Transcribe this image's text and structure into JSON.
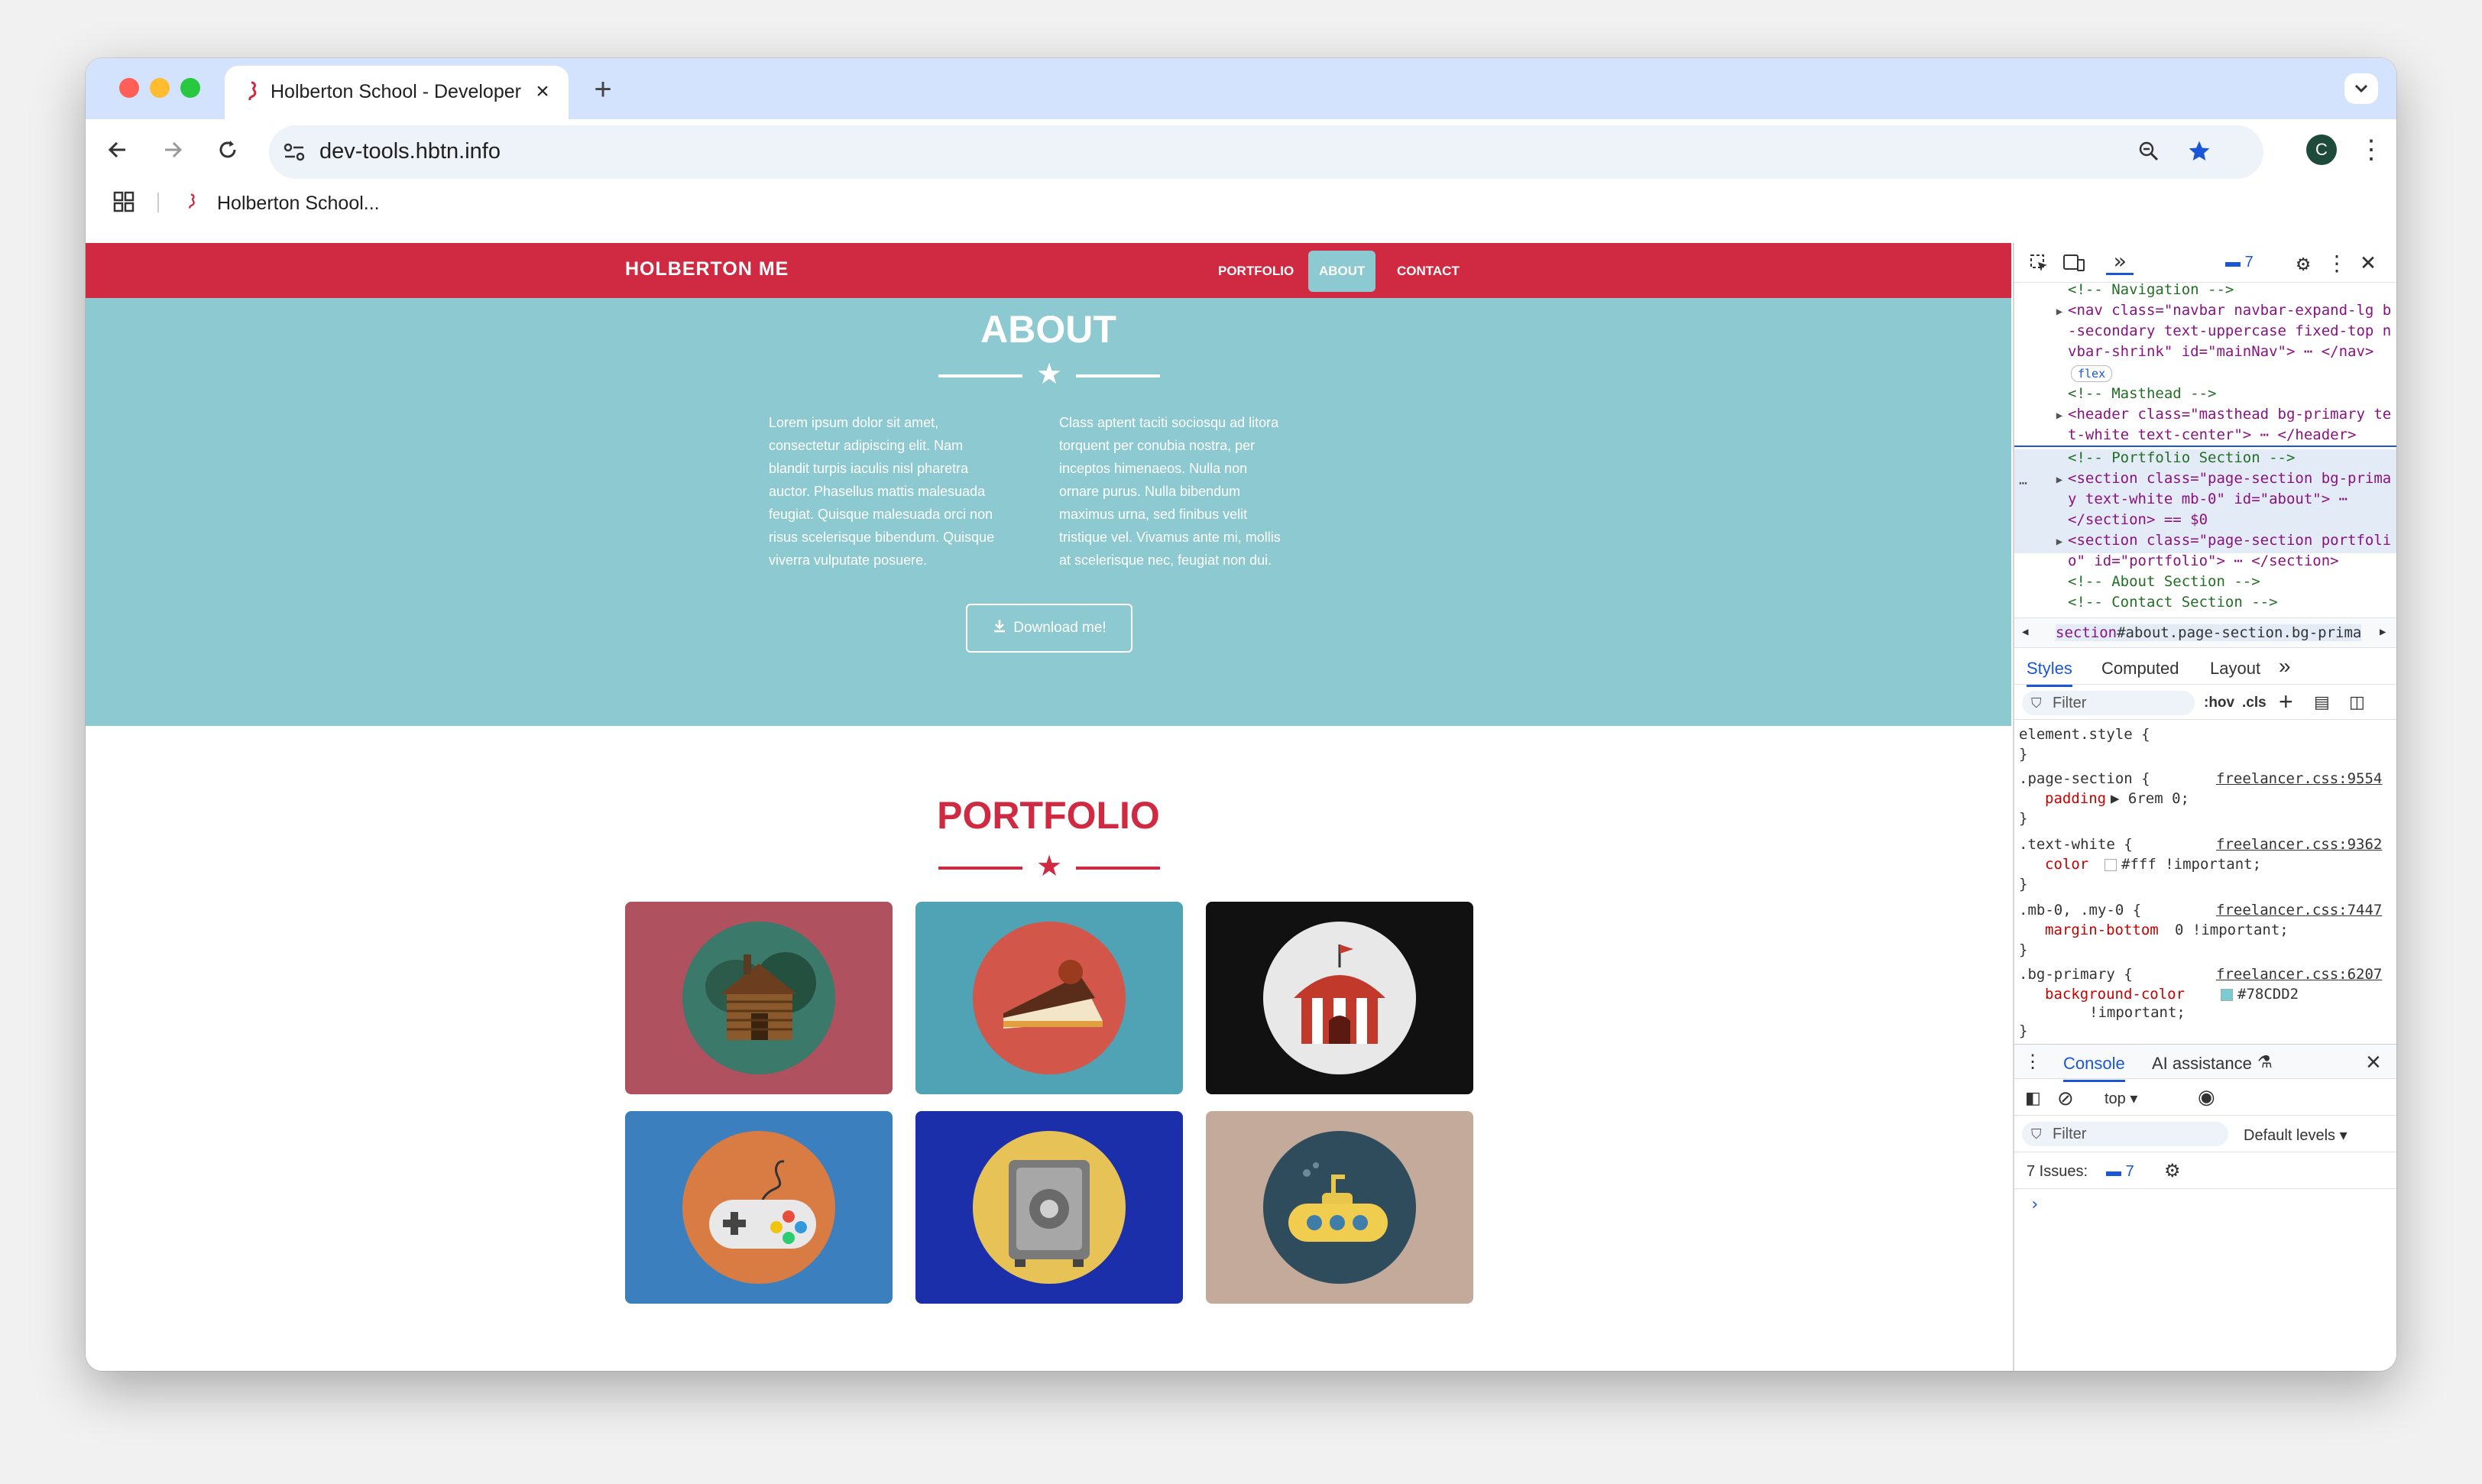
{
  "browser": {
    "tab_title": "Holberton School - Developer",
    "url": "dev-tools.hbtn.info",
    "bookmark_label": "Holberton School...",
    "profile_initial": "C",
    "colors": {
      "tabbar": "#d3e3fd",
      "close": "#ff5f57",
      "minimize": "#febc2e",
      "maximize": "#28c840"
    }
  },
  "site": {
    "brand": "HOLBERTON ME",
    "nav": [
      "PORTFOLIO",
      "ABOUT",
      "CONTACT"
    ],
    "active_nav": "ABOUT",
    "about_title": "ABOUT",
    "about_col1": "Lorem ipsum dolor sit amet, consectetur adipiscing elit. Nam blandit turpis iaculis nisl pharetra auctor. Phasellus mattis malesuada feugiat. Quisque malesuada orci non risus scelerisque bibendum. Quisque viverra vulputate posuere.",
    "about_col2": "Class aptent taciti sociosqu ad litora torquent per conubia nostra, per inceptos himenaeos. Nulla non ornare purus. Nulla bibendum maximus urna, sed finibus velit tristique vel. Vivamus ante mi, mollis at scelerisque nec, feugiat non dui.",
    "download_label": "Download me!",
    "portfolio_title": "PORTFOLIO",
    "portfolio_items": [
      {
        "name": "cabin",
        "bg": "#b05160",
        "circle": "#3b7a6a"
      },
      {
        "name": "cake",
        "bg": "#4fa3b5",
        "circle": "#d2574a"
      },
      {
        "name": "circus",
        "bg": "#111111",
        "circle": "#e8e8e8"
      },
      {
        "name": "game",
        "bg": "#3b7fbf",
        "circle": "#d97c43"
      },
      {
        "name": "safe",
        "bg": "#1b2faa",
        "circle": "#e7c257"
      },
      {
        "name": "submarine",
        "bg": "#c4aa9b",
        "circle": "#2f4c5c"
      }
    ],
    "colors": {
      "primary": "#cf2a41",
      "about_bg": "#8dc9d0"
    }
  },
  "devtools": {
    "issues_badge": "7",
    "elements": [
      {
        "kind": "comment",
        "text": "<!-- Navigation -->"
      },
      {
        "kind": "tag",
        "text": "<nav class=\"navbar navbar-expand-lg b"
      },
      {
        "kind": "tag",
        "text": "-secondary text-uppercase fixed-top n"
      },
      {
        "kind": "tag",
        "text": "vbar-shrink\" id=\"mainNav\"> ⋯ </nav>"
      },
      {
        "kind": "badge",
        "text": "flex"
      },
      {
        "kind": "comment",
        "text": "<!-- Masthead -->"
      },
      {
        "kind": "tag",
        "text": "<header class=\"masthead bg-primary te"
      },
      {
        "kind": "tag",
        "text": "t-white text-center\"> ⋯ </header>"
      },
      {
        "kind": "comment",
        "text": "<!-- Portfolio Section -->"
      },
      {
        "kind": "tag",
        "text": "<section class=\"page-section bg-prima"
      },
      {
        "kind": "tag",
        "text": "y text-white mb-0\" id=\"about\"> ⋯"
      },
      {
        "kind": "tag",
        "text": "</section> == $0"
      },
      {
        "kind": "tag",
        "text": "<section class=\"page-section portfoli"
      },
      {
        "kind": "tag",
        "text": "o\" id=\"portfolio\"> ⋯ </section>"
      },
      {
        "kind": "comment",
        "text": "<!-- About Section -->"
      },
      {
        "kind": "comment",
        "text": "<!-- Contact Section -->"
      }
    ],
    "breadcrumb_tag": "section",
    "breadcrumb_rest": "#about.page-section.bg-primary",
    "style_tabs": [
      "Styles",
      "Computed",
      "Layout"
    ],
    "filter_placeholder": "Filter",
    "hov": ":hov",
    "cls": ".cls",
    "rules": [
      {
        "sel": "element.style {",
        "src": "",
        "prop": "",
        "val": ""
      },
      {
        "sel": ".page-section {",
        "src": "freelancer.css:9554",
        "prop": "padding",
        "val": "▶ 6rem 0;"
      },
      {
        "sel": ".text-white {",
        "src": "freelancer.css:9362",
        "prop": "color",
        "val": "#fff !important;"
      },
      {
        "sel": ".mb-0, .my-0 {",
        "src": "freelancer.css:7447",
        "prop": "margin-bottom",
        "val": "0 !important;"
      },
      {
        "sel": ".bg-primary {",
        "src": "freelancer.css:6207",
        "prop": "background-color",
        "val": "#78CDD2"
      }
    ],
    "bg_important": "!important;",
    "console_tab": "Console",
    "ai_tab": "AI assistance",
    "context": "top",
    "console_filter": "Filter",
    "levels": "Default levels",
    "issues_text": "7 Issues:",
    "issues_count": "7"
  }
}
